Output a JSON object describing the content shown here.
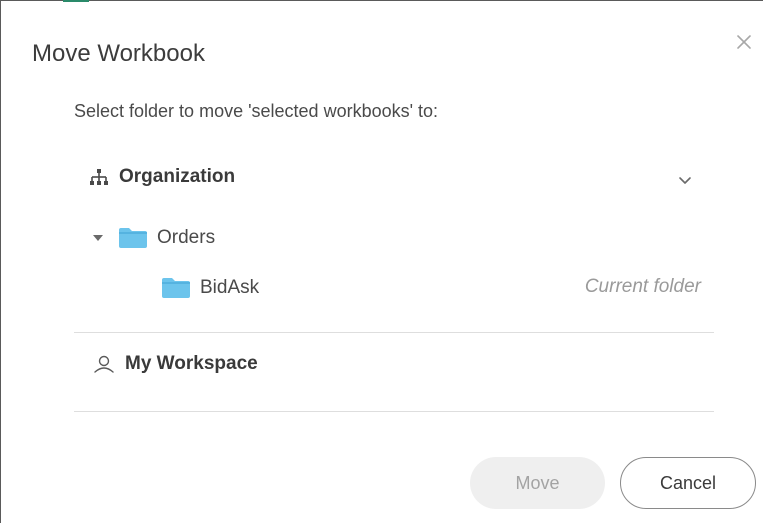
{
  "dialog": {
    "title": "Move Workbook",
    "prompt": "Select folder to move 'selected workbooks' to:"
  },
  "tree": {
    "organization": {
      "label": "Organization",
      "icon": "hierarchy-icon"
    },
    "orders": {
      "label": "Orders",
      "icon": "folder-icon",
      "expanded": true
    },
    "bidask": {
      "label": "BidAsk",
      "icon": "folder-icon",
      "note": "Current folder"
    },
    "workspace": {
      "label": "My Workspace",
      "icon": "user-icon"
    }
  },
  "buttons": {
    "move": "Move",
    "cancel": "Cancel"
  },
  "colors": {
    "folder": "#6cc4ec",
    "folder_tab": "#55b3e0",
    "divider": "#dedede",
    "disabled_button_bg": "#efefef"
  }
}
